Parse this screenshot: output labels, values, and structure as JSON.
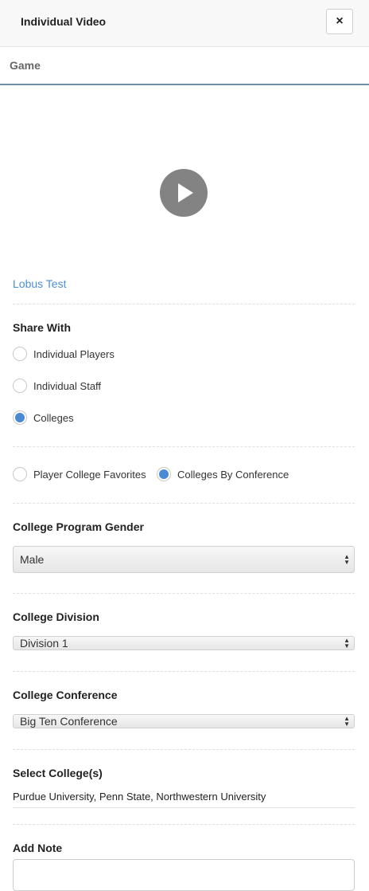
{
  "header": {
    "title": "Individual Video",
    "close_icon": "×"
  },
  "subheader": {
    "label": "Game"
  },
  "video": {
    "link": "Lobus Test"
  },
  "share": {
    "label": "Share With",
    "options": [
      "Individual Players",
      "Individual Staff",
      "Colleges"
    ],
    "selected": "Colleges"
  },
  "college_filter": {
    "options": [
      "Player College Favorites",
      "Colleges By Conference"
    ],
    "selected": "Colleges By Conference"
  },
  "gender": {
    "label": "College Program Gender",
    "value": "Male"
  },
  "division": {
    "label": "College Division",
    "value": "Division 1"
  },
  "conference": {
    "label": "College Conference",
    "value": "Big Ten Conference"
  },
  "colleges": {
    "label": "Select College(s)",
    "value": "Purdue University, Penn State, Northwestern University"
  },
  "note": {
    "label": "Add Note"
  },
  "colors": {
    "link": "#4a90d9",
    "radio_checked": "#4a8ad4",
    "accent_line": "#6d8fa6"
  }
}
